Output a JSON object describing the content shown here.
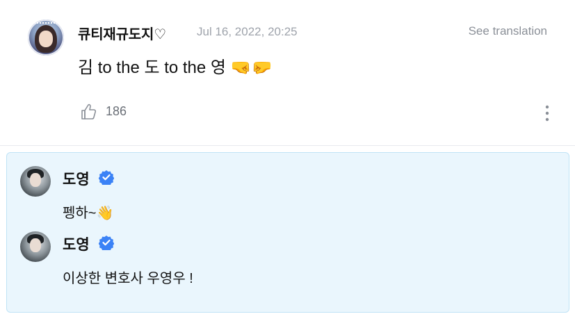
{
  "post": {
    "username": "큐티재규도지♡",
    "timestamp": "Jul 16, 2022, 20:25",
    "translate_label": "See translation",
    "text": "김 to the 도 to the 영 🤜🤛",
    "like_count": "186",
    "icons": {
      "like": "thumbs-up-icon",
      "more": "more-vertical-icon"
    }
  },
  "replies": [
    {
      "author": "도영",
      "verified": true,
      "text": "펭하~👋"
    },
    {
      "author": "도영",
      "verified": true,
      "text": "이상한 변호사 우영우 !"
    }
  ],
  "colors": {
    "timestamp": "#9ea3ab",
    "reply_background": "#eaf6fd",
    "reply_border": "#bfe3f6",
    "verified_badge": "#3b82f6"
  }
}
